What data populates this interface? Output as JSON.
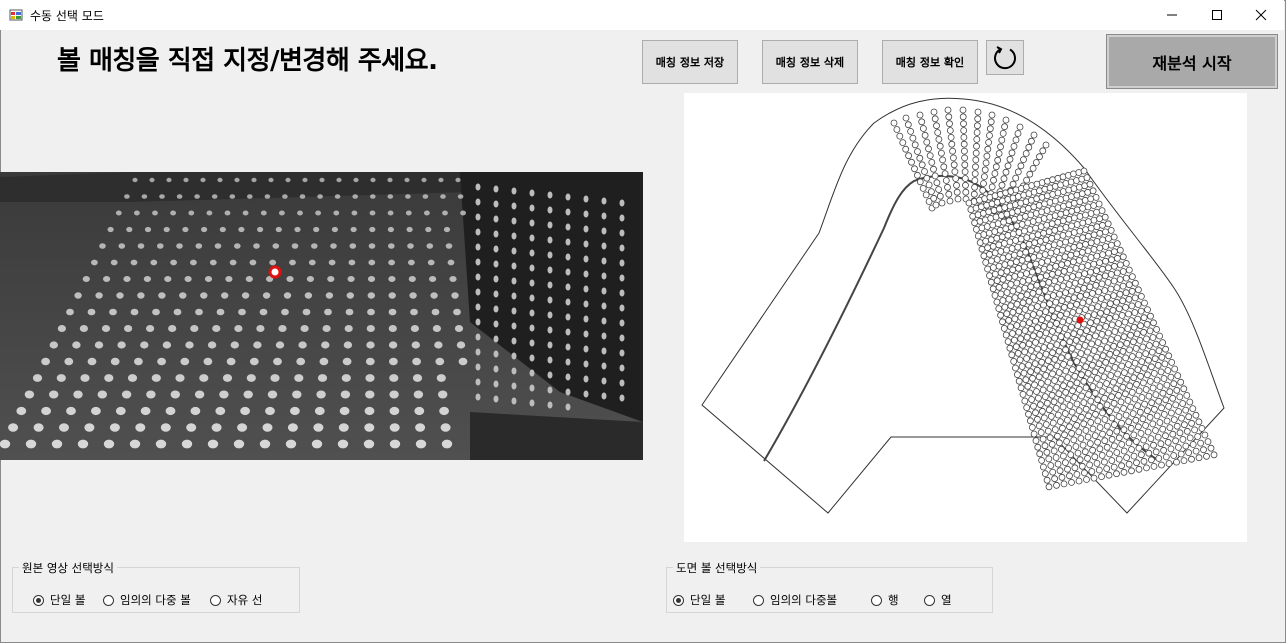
{
  "window": {
    "title": "수동 선택 모드",
    "minimize_icon": "minimize-icon",
    "maximize_icon": "maximize-icon",
    "close_icon": "close-icon"
  },
  "headline": "볼 매칭을 직접 지정/변경해 주세요.",
  "toolbar": {
    "save_label": "매칭 정보 저장",
    "delete_label": "매칭 정보 삭제",
    "confirm_label": "매칭 정보 확인",
    "refresh_icon": "refresh-icon",
    "reanalyze_label": "재분석 시작"
  },
  "source_group": {
    "title": "원본 영상 선택방식",
    "options": [
      "단일 볼",
      "임의의 다중 볼",
      "자유 선"
    ],
    "selected": "단일 볼"
  },
  "drawing_group": {
    "title": "도면 볼 선택방식",
    "options": [
      "단일 볼",
      "임의의 다중볼",
      "행",
      "열"
    ],
    "selected": "단일 볼"
  },
  "colors": {
    "selection_marker": "#e01010",
    "reanalyze_bg": "#a9a9a9",
    "button_bg": "#e1e1e1"
  }
}
